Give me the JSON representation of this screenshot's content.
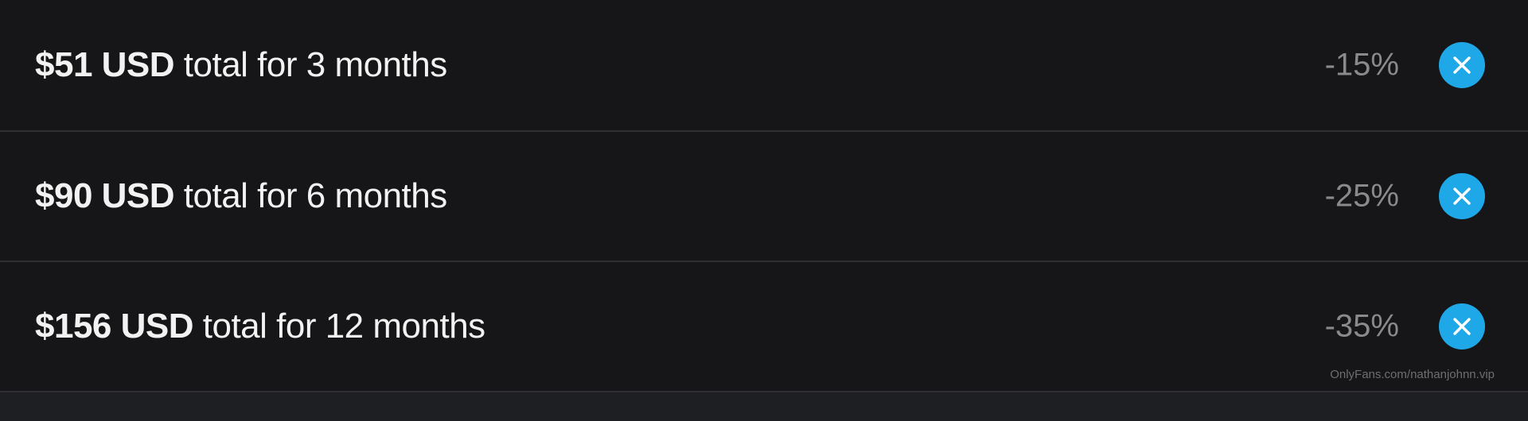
{
  "bundles": [
    {
      "price": "$51 USD",
      "description": "total for 3 months",
      "discount": "-15%"
    },
    {
      "price": "$90 USD",
      "description": "total for 6 months",
      "discount": "-25%"
    },
    {
      "price": "$156 USD",
      "description": "total for 12 months",
      "discount": "-35%"
    }
  ],
  "watermark": "OnlyFans.com/nathanjohnn.vip",
  "icons": {
    "remove": "close-icon"
  },
  "colors": {
    "background": "#161618",
    "divider": "#303034",
    "accent": "#1fa8e8",
    "discount_text": "#8a8a8e"
  }
}
